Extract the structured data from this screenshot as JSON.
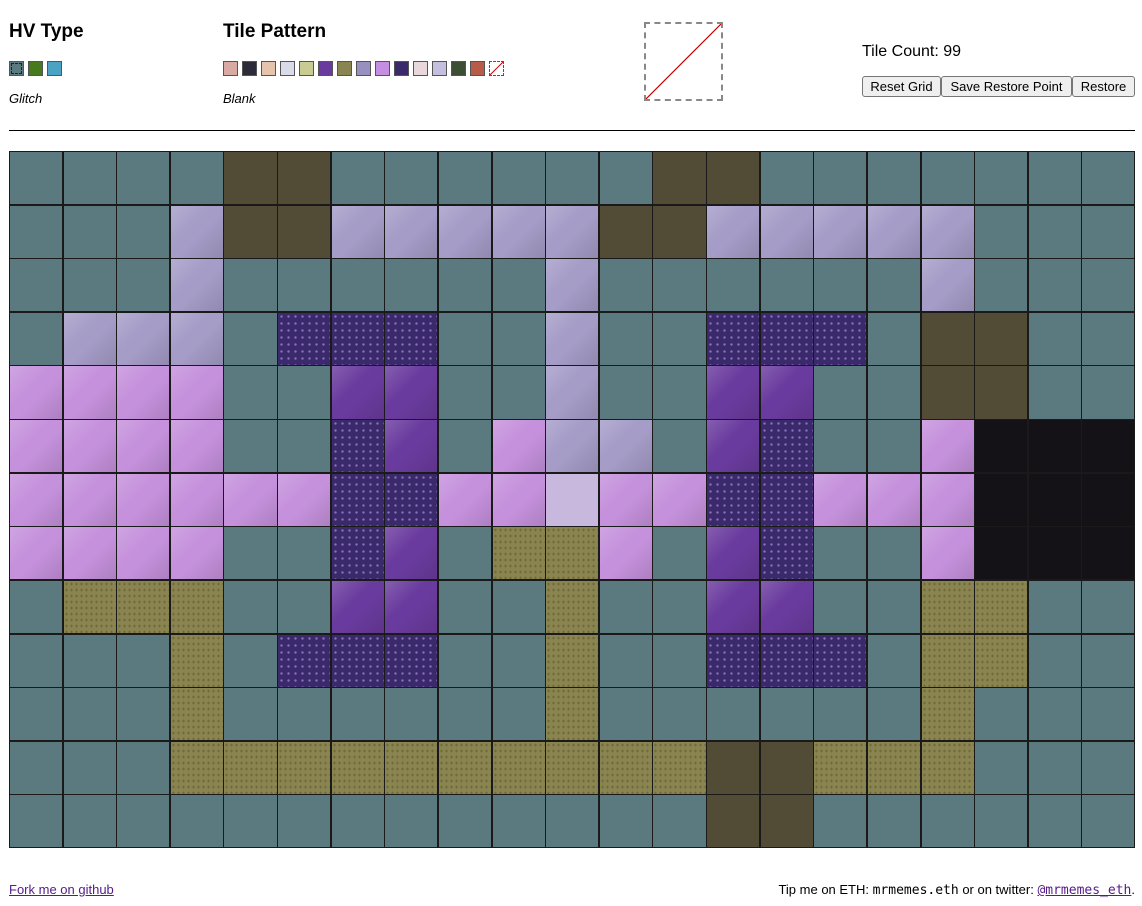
{
  "hv_type": {
    "heading": "HV Type",
    "selected_label": "Glitch",
    "swatches": [
      {
        "name": "glitch",
        "color": "#5b7a80",
        "selected": true
      },
      {
        "name": "green",
        "color": "#477a1f"
      },
      {
        "name": "cyan",
        "color": "#4aa3c2"
      }
    ]
  },
  "tile_pattern": {
    "heading": "Tile Pattern",
    "selected_label": "Blank",
    "swatches": [
      "#d9aaa3",
      "#2c2b3a",
      "#e6c3ad",
      "#d9dbe8",
      "#c8cb92",
      "#6a3b9e",
      "#8a8450",
      "#9891c0",
      "#c58ee0",
      "#3b2a6b",
      "#ead7dc",
      "#c4bfe0",
      "#3c4f35",
      "#b85c4a",
      "blank"
    ]
  },
  "preview": {
    "mode": "blank",
    "color": "#cc0000"
  },
  "tile_count": {
    "text": "Tile Count: 99"
  },
  "buttons": {
    "reset": "Reset Grid",
    "save": "Save Restore Point",
    "restore": "Restore"
  },
  "footer": {
    "fork_link": "Fork me on github",
    "tip_text": "Tip me on ETH: ",
    "eth_name": "mrmemes.eth",
    "twitter_text": " or on twitter: ",
    "twitter_handle": "@mrmemes_eth",
    "tip_end": "."
  },
  "grid": {
    "cols": 21,
    "rows": 13,
    "palette": {
      ".": {
        "color": "#5b7a80",
        "style": "flat"
      },
      "D": {
        "color": "#524c37",
        "style": "flat"
      },
      "L": {
        "color": "#a59cc7",
        "style": "tex"
      },
      "P": {
        "color": "#3b2a6b",
        "style": "dots"
      },
      "V": {
        "color": "#6a3b9e",
        "style": "tex"
      },
      "M": {
        "color": "#c591dc",
        "style": "tex"
      },
      "W": {
        "color": "#c9b8dd",
        "style": "flat"
      },
      "O": {
        "color": "#8a8450",
        "style": "grain"
      },
      "K": {
        "color": "#141216",
        "style": "flat"
      }
    },
    "rows_data": [
      "....DD......DD.......",
      "...LDDLLLLLDDLLLLL...",
      "...L......L......L...",
      ".LLL.PPP..L..PPP.DD..",
      "MMMM..VV..L..VV..DD..",
      "MMMM..PV.MLL.VP..MKKK",
      "MMMMMMPPMMWMMPPMMMKKK",
      "MMMM..PV.OOM.VP..MKKK",
      ".OOO..VV..O..VV..OO..",
      "...O.PPP..O..PPP.OO..",
      "...O......O......O...",
      "...OOOOOOOOOODDOOO...",
      ".............DD......"
    ]
  }
}
